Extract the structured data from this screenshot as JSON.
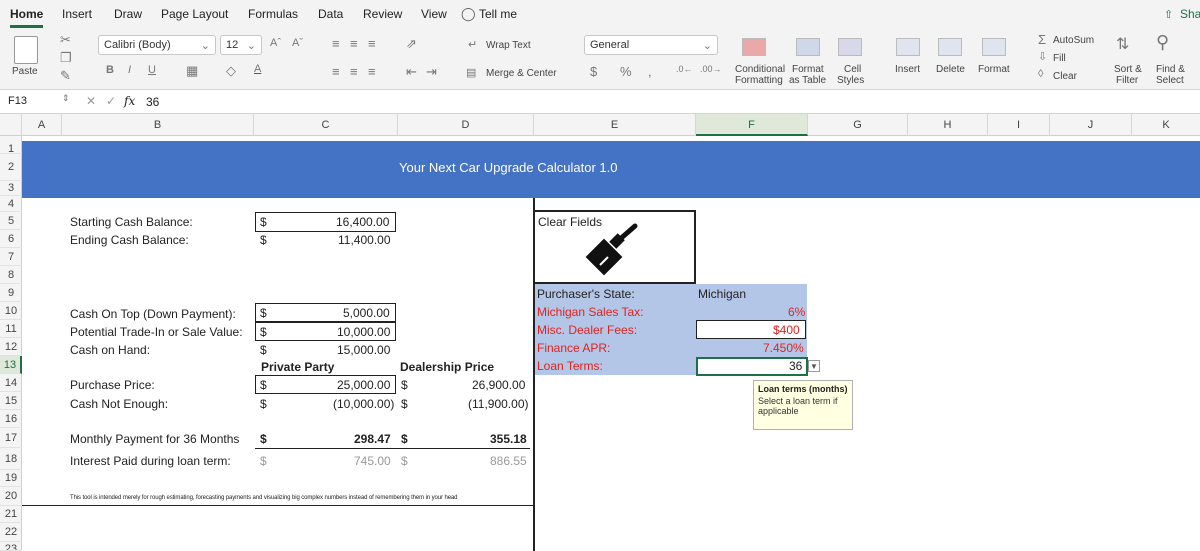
{
  "tabs": [
    "Home",
    "Insert",
    "Draw",
    "Page Layout",
    "Formulas",
    "Data",
    "Review",
    "View",
    "Tell me"
  ],
  "share_label": "Sha",
  "ribbon": {
    "paste": "Paste",
    "font_name": "Calibri (Body)",
    "font_size": "12",
    "wrap_text": "Wrap Text",
    "merge_center": "Merge & Center",
    "number_format": "General",
    "cond_format_1": "Conditional",
    "cond_format_2": "Formatting",
    "format_table_1": "Format",
    "format_table_2": "as Table",
    "cell_styles_1": "Cell",
    "cell_styles_2": "Styles",
    "insert": "Insert",
    "delete": "Delete",
    "format": "Format",
    "autosum": "AutoSum",
    "fill": "Fill",
    "clear": "Clear",
    "sort_1": "Sort &",
    "sort_2": "Filter",
    "find_1": "Find &",
    "find_2": "Select"
  },
  "formula_bar": {
    "name_box": "F13",
    "fx": "fx",
    "value": "36"
  },
  "columns": [
    "A",
    "B",
    "C",
    "D",
    "E",
    "F",
    "G",
    "H",
    "I",
    "J",
    "K"
  ],
  "rows": [
    "1",
    "2",
    "3",
    "4",
    "5",
    "6",
    "7",
    "8",
    "9",
    "10",
    "11",
    "12",
    "13",
    "14",
    "15",
    "16",
    "17",
    "18",
    "19",
    "20",
    "21",
    "22",
    "23"
  ],
  "sheet": {
    "title": "Your Next Car Upgrade Calculator 1.0",
    "starting_cash_label": "Starting Cash Balance:",
    "starting_cash_sym": "$",
    "starting_cash_value": "16,400.00",
    "ending_cash_label": "Ending Cash Balance:",
    "ending_cash_sym": "$",
    "ending_cash_value": "11,400.00",
    "clear_fields": "Clear Fields",
    "down_payment_label": "Cash On Top (Down Payment):",
    "down_payment_sym": "$",
    "down_payment_value": "5,000.00",
    "trade_in_label": "Potential Trade-In or Sale Value:",
    "trade_in_sym": "$",
    "trade_in_value": "10,000.00",
    "cash_on_hand_label": "Cash on Hand:",
    "cash_on_hand_sym": "$",
    "cash_on_hand_value": "15,000.00",
    "private_party": "Private Party",
    "dealership_price": "Dealership Price",
    "purchase_price_label": "Purchase Price:",
    "purchase_sym": "$",
    "purchase_private": "25,000.00",
    "purchase_dealer_sym": "$",
    "purchase_dealer": "26,900.00",
    "not_enough_label": "Cash Not Enough:",
    "not_enough_sym": "$",
    "not_enough_private": "(10,000.00)",
    "not_enough_dealer_sym": "$",
    "not_enough_dealer": "(11,900.00)",
    "monthly_label": "Monthly Payment for 36 Months",
    "monthly_sym": "$",
    "monthly_private": "298.47",
    "monthly_dealer_sym": "$",
    "monthly_dealer": "355.18",
    "interest_label": "Interest Paid during loan term:",
    "interest_sym": "$",
    "interest_private": "745.00",
    "interest_dealer_sym": "$",
    "interest_dealer": "886.55",
    "disclaimer": "This tool is intended merely for rough estimating, forecasting payments and visualizing big complex numbers instead of remembering them in your head",
    "state_label": "Purchaser's State:",
    "state_value": "Michigan",
    "sales_tax_label": "Michigan Sales Tax:",
    "sales_tax_value": "6%",
    "dealer_fees_label": "Misc. Dealer Fees:",
    "dealer_fees_value": "$400",
    "apr_label": "Finance APR:",
    "apr_value": "7.450%",
    "loan_terms_label": "Loan Terms:",
    "loan_terms_value": "36",
    "tooltip_title": "Loan terms (months)",
    "tooltip_body": "Select a loan term if applicable"
  },
  "colors": {
    "accent": "#1e7145",
    "header_blue": "#4472c4",
    "input_blue": "#b4c6e7",
    "red": "#e0231f"
  }
}
